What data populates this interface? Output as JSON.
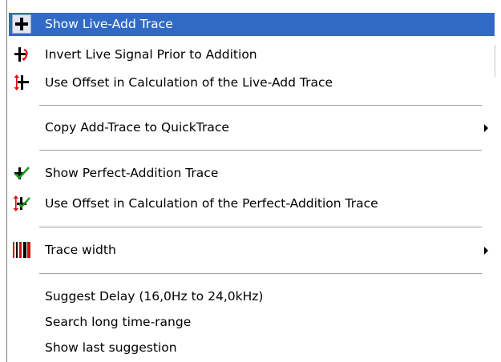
{
  "menu": {
    "items": [
      {
        "label": "Show Live-Add Trace",
        "icon": "plus-icon"
      },
      {
        "label": "Invert Live Signal Prior to Addition",
        "icon": "invert-plus-icon"
      },
      {
        "label": "Use Offset in Calculation of the Live-Add Trace",
        "icon": "offset-plus-icon"
      },
      {
        "label": "Copy Add-Trace to QuickTrace",
        "icon": "",
        "submenu": true
      },
      {
        "label": "Show Perfect-Addition Trace",
        "icon": "checkmark-plus-icon"
      },
      {
        "label": "Use Offset in Calculation of the Perfect-Addition Trace",
        "icon": "offset-checkmark-icon"
      },
      {
        "label": "Trace width",
        "icon": "trace-width-icon",
        "submenu": true
      },
      {
        "label": "Suggest Delay (16,0Hz to 24,0kHz)",
        "icon": ""
      },
      {
        "label": "Search long time-range",
        "icon": ""
      },
      {
        "label": "Show last suggestion",
        "icon": ""
      }
    ],
    "highlight_color": "#316ac5"
  }
}
